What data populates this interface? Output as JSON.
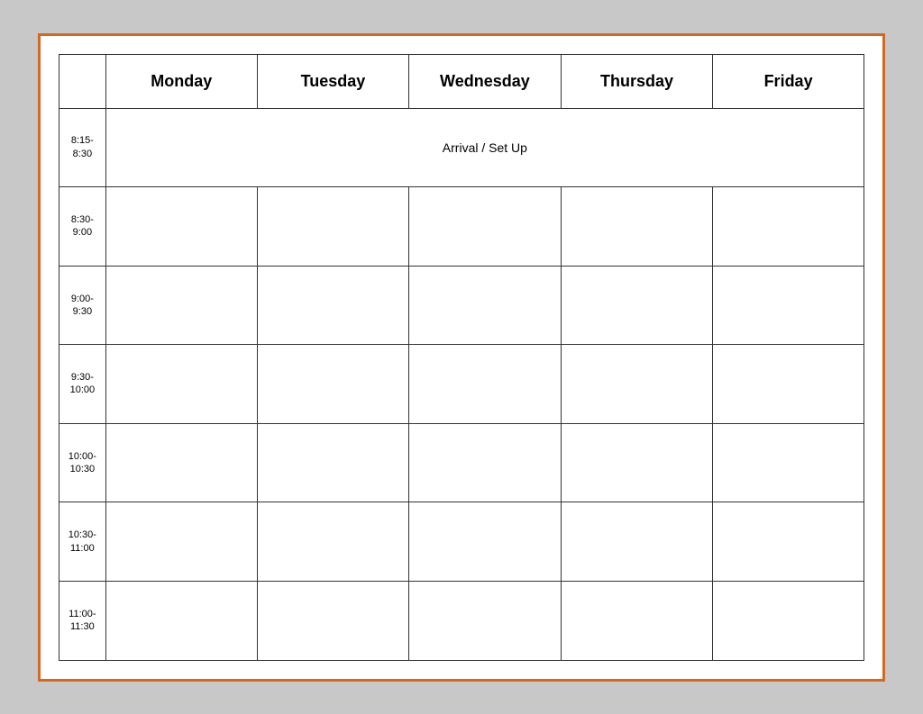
{
  "table": {
    "headers": {
      "empty": "",
      "monday": "Monday",
      "tuesday": "Tuesday",
      "wednesday": "Wednesday",
      "thursday": "Thursday",
      "friday": "Friday"
    },
    "rows": [
      {
        "time": "8:15-\n8:30",
        "arrival_text": "Arrival / Set Up",
        "colspan": 5,
        "is_arrival": true
      },
      {
        "time": "8:30-\n9:00",
        "cells": [
          "",
          "",
          "",
          "",
          ""
        ]
      },
      {
        "time": "9:00-\n9:30",
        "cells": [
          "",
          "",
          "",
          "",
          ""
        ]
      },
      {
        "time": "9:30-\n10:00",
        "cells": [
          "",
          "",
          "",
          "",
          ""
        ]
      },
      {
        "time": "10:00-\n10:30",
        "cells": [
          "",
          "",
          "",
          "",
          ""
        ]
      },
      {
        "time": "10:30-\n11:00",
        "cells": [
          "",
          "",
          "",
          "",
          ""
        ]
      },
      {
        "time": "11:00-\n11:30",
        "cells": [
          "",
          "",
          "",
          "",
          ""
        ]
      }
    ]
  }
}
